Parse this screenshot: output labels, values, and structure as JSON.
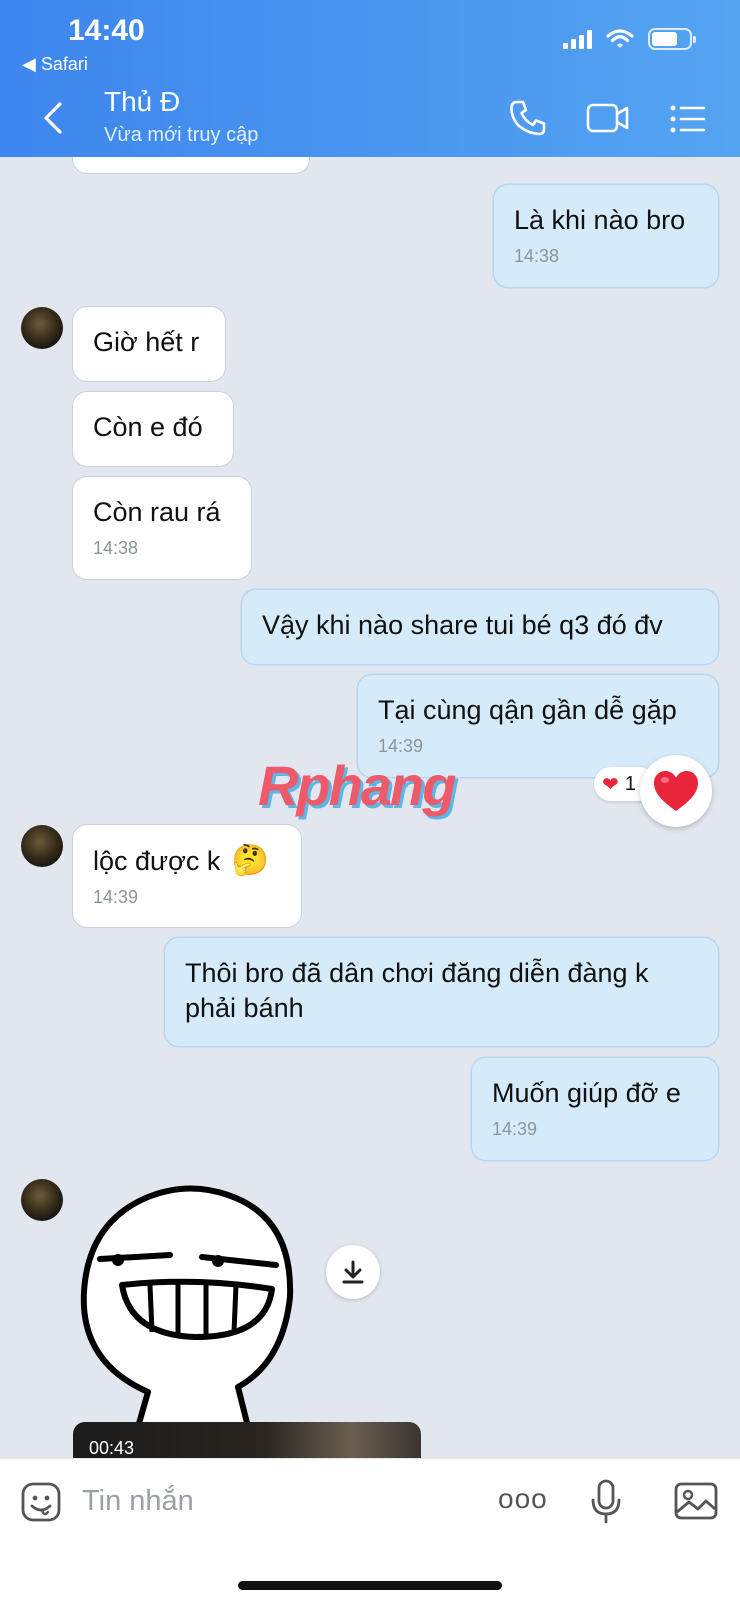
{
  "status_bar": {
    "time": "14:40",
    "back_app": "◀ Safari"
  },
  "header": {
    "contact_name": "Thủ Đ",
    "contact_status": "Vừa mới truy cập"
  },
  "messages": [
    {
      "dir": "out",
      "text": "Là khi nào bro",
      "time": "14:38"
    },
    {
      "dir": "in",
      "text": "Giờ hết r"
    },
    {
      "dir": "in",
      "text": "Còn e đó"
    },
    {
      "dir": "in",
      "text": "Còn rau rá",
      "time": "14:38"
    },
    {
      "dir": "out",
      "text": "Vậy khi nào share tui bé q3 đó đv"
    },
    {
      "dir": "out",
      "text": "Tại cùng qận gần dễ gặp",
      "time": "14:39"
    },
    {
      "dir": "in",
      "text": "lộc được k",
      "emoji": "🤔",
      "time": "14:39"
    },
    {
      "dir": "out",
      "text": "Thôi bro đã dân chơi đăng diễn đàng k phải bánh"
    },
    {
      "dir": "out",
      "text": "Muốn giúp đỡ e",
      "time": "14:39"
    }
  ],
  "reaction": {
    "emoji": "❤",
    "count": "1"
  },
  "watermark": "Rphang",
  "video": {
    "duration": "00:43"
  },
  "input": {
    "placeholder": "Tin nhắn",
    "more": "ooo"
  },
  "colors": {
    "header": "#4590ef",
    "bubble_out": "#d6ebfa",
    "bubble_in": "#ffffff",
    "background": "#e2e7ef"
  }
}
